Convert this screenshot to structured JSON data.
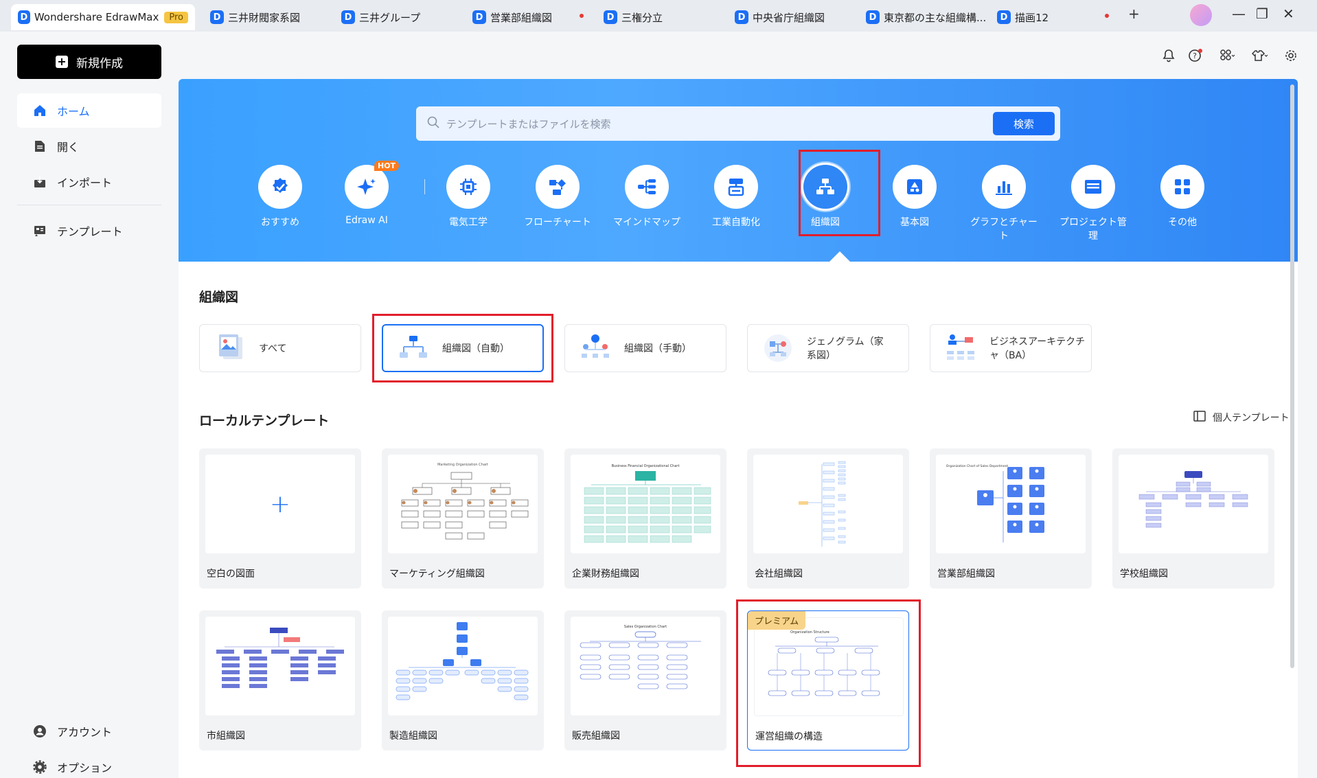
{
  "app": {
    "name": "Wondershare EdrawMax",
    "badge": "Pro"
  },
  "tabs": [
    {
      "label": "三井財閥家系図"
    },
    {
      "label": "三井グループ"
    },
    {
      "label": "営業部組織図"
    },
    {
      "label": "三権分立"
    },
    {
      "label": "中央省庁組織図"
    },
    {
      "label": "東京都の主な組織構..."
    },
    {
      "label": "描画12"
    }
  ],
  "window": {
    "new_tab": "+",
    "minimize": "—",
    "restore": "❐",
    "close": "✕"
  },
  "sidebar": {
    "new_label": "新規作成",
    "items": [
      {
        "label": "ホーム"
      },
      {
        "label": "開く"
      },
      {
        "label": "インポート"
      },
      {
        "label": "テンプレート"
      }
    ],
    "bottom": [
      {
        "label": "アカウント"
      },
      {
        "label": "オプション"
      }
    ]
  },
  "search": {
    "placeholder": "テンプレートまたはファイルを検索",
    "button": "検索"
  },
  "categories": [
    {
      "label": "おすすめ"
    },
    {
      "label": "Edraw AI",
      "badge": "HOT"
    },
    {
      "label": "電気工学"
    },
    {
      "label": "フローチャート"
    },
    {
      "label": "マインドマップ"
    },
    {
      "label": "工業自動化"
    },
    {
      "label": "組織図"
    },
    {
      "label": "基本図"
    },
    {
      "label": "グラフとチャート"
    },
    {
      "label": "プロジェクト管理"
    },
    {
      "label": "その他"
    }
  ],
  "section": {
    "title": "組織図"
  },
  "subcategories": [
    {
      "label": "すべて"
    },
    {
      "label": "組織図（自動）"
    },
    {
      "label": "組織図（手動）"
    },
    {
      "label": "ジェノグラム（家系図）"
    },
    {
      "label": "ビジネスアーキテクチャ（BA）"
    }
  ],
  "local": {
    "title": "ローカルテンプレート",
    "personal": "個人テンプレート"
  },
  "templates": [
    {
      "name": "空白の図面"
    },
    {
      "name": "マーケティング組織図",
      "thumb_title": "Marketing Organization Chart"
    },
    {
      "name": "企業財務組織図",
      "thumb_title": "Business Financial Organizational Chart"
    },
    {
      "name": "会社組織図"
    },
    {
      "name": "営業部組織図",
      "thumb_title": "Organization Chart of Sales Department"
    },
    {
      "name": "学校組織図"
    },
    {
      "name": "市組織図"
    },
    {
      "name": "製造組織図"
    },
    {
      "name": "販売組織図",
      "thumb_title": "Sales Organization Chart"
    },
    {
      "name": "運営組織の構造",
      "premium": "プレミアム",
      "thumb_title": "Organization Structure"
    }
  ],
  "colors": {
    "accent": "#1b6ff5",
    "highlight": "#e21d2b",
    "hero": "#3aa0ff"
  }
}
